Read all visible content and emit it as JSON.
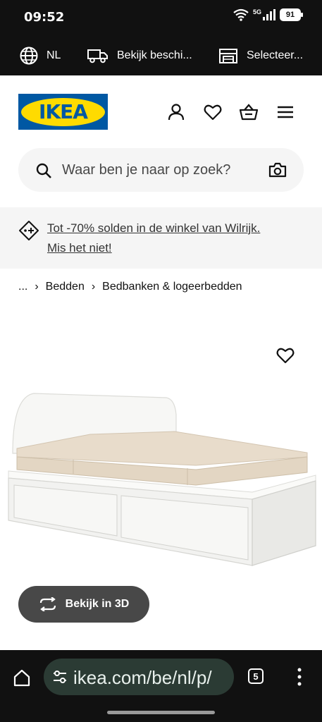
{
  "status": {
    "time": "09:52",
    "battery": "91",
    "network": "5G"
  },
  "topbar": {
    "language": "NL",
    "delivery": "Bekijk beschi...",
    "store": "Selecteer..."
  },
  "header": {
    "logo": "IKEA"
  },
  "search": {
    "placeholder": "Waar ben je naar op zoek?"
  },
  "banner": {
    "line1": "Tot -70% solden in de winkel van Wilrijk.",
    "line2": "Mis het niet!"
  },
  "breadcrumb": {
    "ellipsis": "...",
    "item1": "Bedden",
    "item2": "Bedbanken & logeerbedden"
  },
  "product": {
    "view3d": "Bekijk in 3D"
  },
  "browser": {
    "url": "ikea.com/be/nl/p/",
    "tabs": "5"
  },
  "colors": {
    "ikea_blue": "#0058a3",
    "ikea_yellow": "#ffdb00",
    "mattress": "#e8dccb"
  }
}
